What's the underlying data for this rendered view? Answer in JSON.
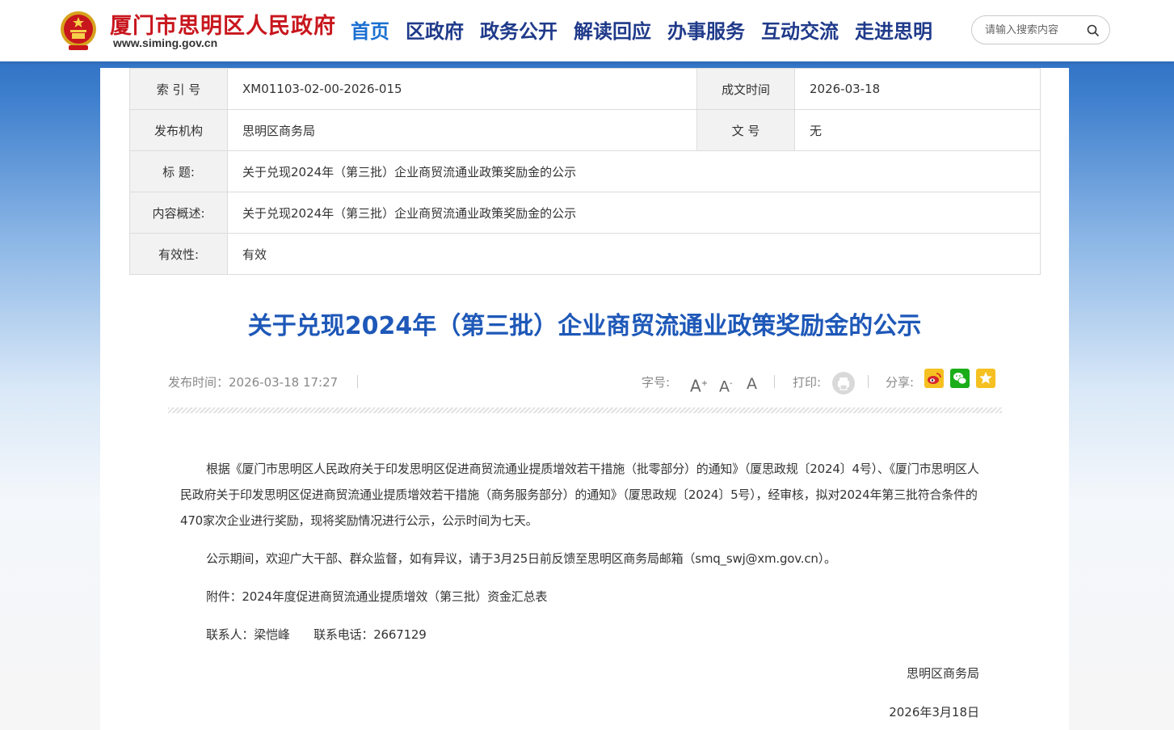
{
  "header": {
    "site_name": "厦门市思明区人民政府",
    "site_url": "www.siming.gov.cn",
    "nav": [
      {
        "label": "首页",
        "active": true
      },
      {
        "label": "区政府"
      },
      {
        "label": "政务公开"
      },
      {
        "label": "解读回应"
      },
      {
        "label": "办事服务"
      },
      {
        "label": "互动交流"
      },
      {
        "label": "走进思明"
      }
    ],
    "search_placeholder": "请输入搜索内容"
  },
  "meta": {
    "index_label": "索 引 号",
    "index_value": "XM01103-02-00-2026-015",
    "date_label": "成文时间",
    "date_value": "2026-03-18",
    "publisher_label": "发布机构",
    "publisher_value": "思明区商务局",
    "docno_label": "文 号",
    "docno_value": "无",
    "title_label": "标 题:",
    "title_value": "关于兑现2024年（第三批）企业商贸流通业政策奖励金的公示",
    "summary_label": "内容概述:",
    "summary_value": "关于兑现2024年（第三批）企业商贸流通业政策奖励金的公示",
    "validity_label": "有效性:",
    "validity_value": "有效"
  },
  "article": {
    "title": "关于兑现2024年（第三批）企业商贸流通业政策奖励金的公示",
    "publish_time": "发布时间：2026-03-18 17:27",
    "font_label": "字号:",
    "font_large": "A",
    "font_medium": "A",
    "font_small": "A",
    "print_label": "打印:",
    "share_label": "分享:",
    "paragraphs": [
      "根据《厦门市思明区人民政府关于印发思明区促进商贸流通业提质增效若干措施（批零部分）的通知》（厦思政规〔2024〕4号）、《厦门市思明区人民政府关于印发思明区促进商贸流通业提质增效若干措施（商务服务部分）的通知》（厦思政规〔2024〕5号），经审核，拟对2024年第三批符合条件的470家次企业进行奖励，现将奖励情况进行公示，公示时间为七天。",
      "公示期间，欢迎广大干部、群众监督，如有异议，请于3月25日前反馈至思明区商务局邮箱（smq_swj@xm.gov.cn）。",
      "附件：2024年度促进商贸流通业提质增效（第三批）资金汇总表",
      "联系人：梁恺峰　　联系电话：2667129"
    ],
    "signature_org": "思明区商务局",
    "signature_date": "2026年3月18日"
  },
  "colors": {
    "brand_red": "#c8161d",
    "nav_blue": "#1f3a8a",
    "title_blue": "#1e58b8"
  },
  "icons": {
    "search": "search-icon",
    "print": "printer-icon",
    "weibo": "weibo-icon",
    "wechat": "wechat-icon",
    "qzone": "star-icon"
  }
}
